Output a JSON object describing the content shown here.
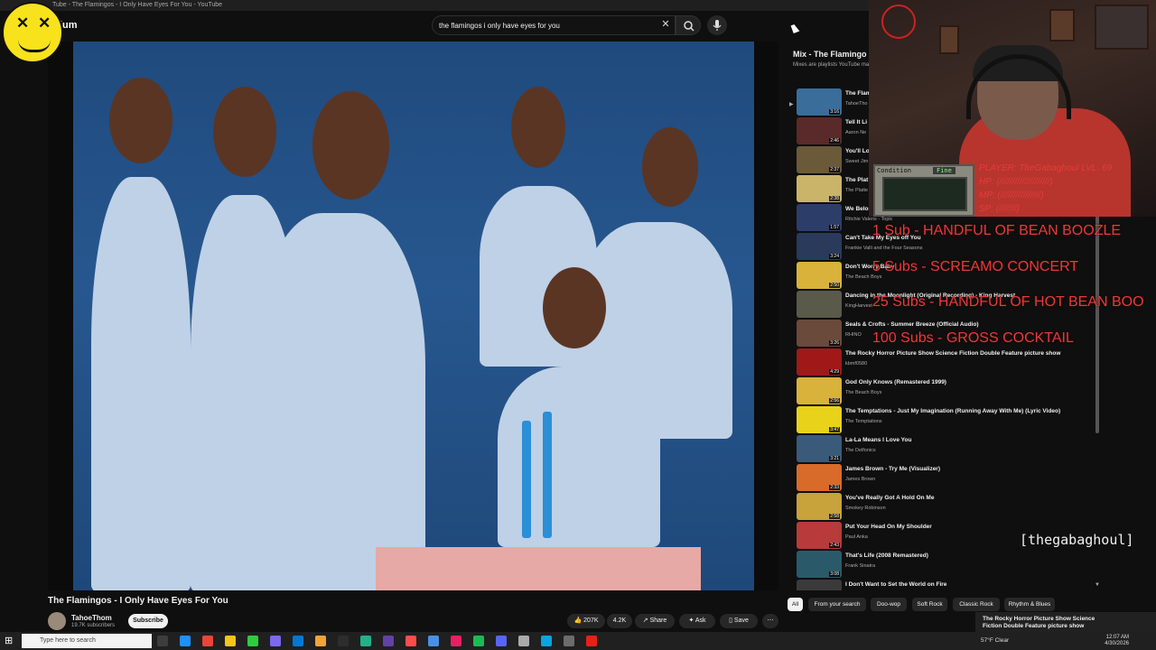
{
  "window": {
    "title": "Tube - The Flamingos - I Only Have Eyes For You - YouTube"
  },
  "header": {
    "logo_suffix": "ium",
    "search_query": "the flamingos i only have eyes for you"
  },
  "video": {
    "title": "The Flamingos - I Only Have Eyes For You",
    "channel": "TahoeThom",
    "subscribers": "19.7K subscribers",
    "subscribe_label": "Subscribe",
    "likes": "207K",
    "share_count": "4.2K",
    "share_label": "Share",
    "ask_label": "Ask",
    "save_label": "Save"
  },
  "playlist": {
    "title": "Mix - The Flamingo",
    "subtitle": "Mixes are playlists YouTube ma",
    "items": [
      {
        "title": "The Flam",
        "artist": "TahoeTho",
        "duration": "3:16",
        "color": "#3a6d9a"
      },
      {
        "title": "Tell It Li",
        "artist": "Aaron Ne",
        "duration": "2:46",
        "color": "#5a2a2a"
      },
      {
        "title": "You'll Lo",
        "artist": "Sweet Jim",
        "duration": "2:37",
        "color": "#6a5a3a"
      },
      {
        "title": "The Plat",
        "artist": "The Platte",
        "duration": "2:38",
        "color": "#c9b46a"
      },
      {
        "title": "We Belon",
        "artist": "Ritchie Valens - Topic",
        "duration": "1:57",
        "color": "#2d3d6a"
      },
      {
        "title": "Can't Take My Eyes off You",
        "artist": "Frankie Valli and the Four Seasons",
        "duration": "3:24",
        "color": "#2a3a5a"
      },
      {
        "title": "Don't Worry Baby",
        "artist": "The Beach Boys",
        "duration": "2:50",
        "color": "#d8b23a"
      },
      {
        "title": "Dancing in the Moonlight (Original Recording) - King Harvest",
        "artist": "KingHarvest",
        "duration": "",
        "color": "#5a5a4a"
      },
      {
        "title": "Seals & Crofts - Summer Breeze (Official Audio)",
        "artist": "RHINO",
        "duration": "3:26",
        "color": "#6a4a3a"
      },
      {
        "title": "The Rocky Horror Picture Show Science Fiction Double Feature picture show",
        "artist": "kbmf0580",
        "duration": "4:29",
        "color": "#a01818"
      },
      {
        "title": "God Only Knows (Remastered 1999)",
        "artist": "The Beach Boys",
        "duration": "2:56",
        "color": "#d8b23a"
      },
      {
        "title": "The Temptations - Just My Imagination (Running Away With Me) (Lyric Video)",
        "artist": "The Temptations",
        "duration": "3:47",
        "color": "#e8d21a"
      },
      {
        "title": "La-La Means I Love You",
        "artist": "The Delfonics",
        "duration": "3:21",
        "color": "#3a5a7a"
      },
      {
        "title": "James Brown - Try Me (Visualizer)",
        "artist": "James Brown",
        "duration": "2:33",
        "color": "#d86a2a"
      },
      {
        "title": "You've Really Got A Hold On Me",
        "artist": "Smokey Robinson",
        "duration": "2:58",
        "color": "#c8a23a"
      },
      {
        "title": "Put Your Head On My Shoulder",
        "artist": "Paul Anka",
        "duration": "2:43",
        "color": "#b83a3a"
      },
      {
        "title": "That's Life (2008 Remastered)",
        "artist": "Frank Sinatra",
        "duration": "3:08",
        "color": "#2a5a6a"
      },
      {
        "title": "I Don't Want to Set the World on Fire",
        "artist": "",
        "duration": "",
        "color": "#3a3a3a"
      }
    ]
  },
  "chips": [
    "All",
    "From your search",
    "Doo-wop",
    "Soft Rock",
    "Classic Rock",
    "Rhythm & Blues"
  ],
  "overlay": {
    "retro_label": "Condition",
    "retro_status": "Fine",
    "stats": [
      "PLAYER: TheGabaghoul LVL. 69",
      "HP:    (////////////////////)",
      "MP:    (////////////////)",
      "SP:  (///////)"
    ],
    "goals": [
      "1 Sub - HANDFUL OF BEAN BOOZLE",
      "5 Subs - SCREAMO CONCERT",
      "25 Subs - HANDFUL OF HOT BEAN BOO",
      "100 Subs - GROSS COCKTAIL"
    ],
    "handle": "[thegabaghoul]",
    "goal_color": "#e53b3b"
  },
  "toast": {
    "text": "The Rocky Horror Picture Show Science Fiction Double Feature picture show"
  },
  "taskbar": {
    "search_placeholder": "Type here to search",
    "weather": "57°F  Clear",
    "time": "12:07 AM",
    "date": "4/30/2026"
  }
}
